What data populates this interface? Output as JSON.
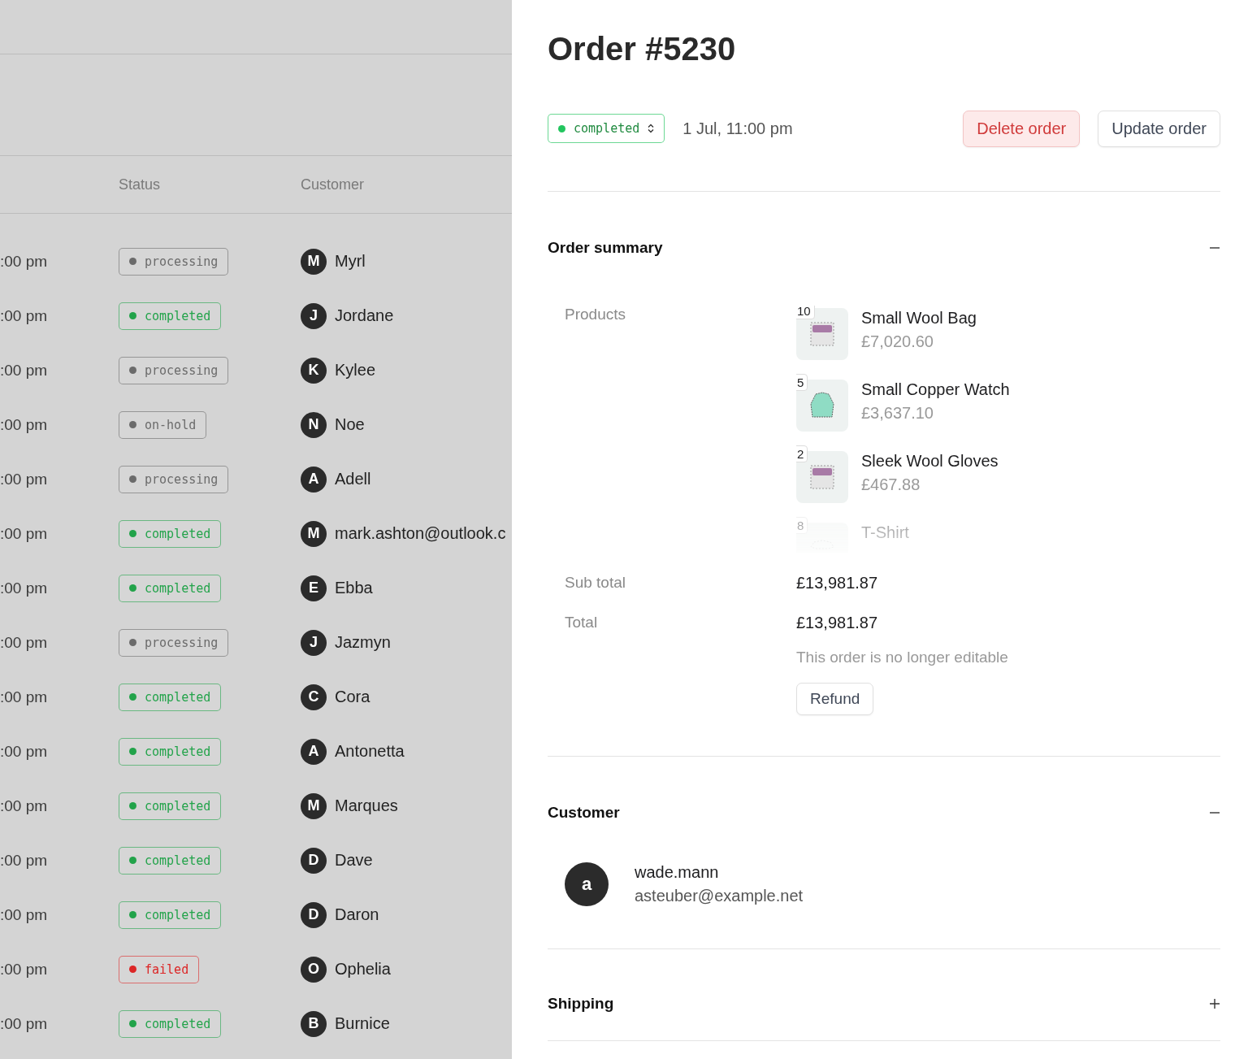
{
  "orders_table": {
    "columns": [
      "Status",
      "Customer"
    ],
    "rows": [
      {
        "time": ":00 pm",
        "status": {
          "label": "processing",
          "color": "#6b6b6b"
        },
        "initial": "M",
        "customer": "Myrl"
      },
      {
        "time": ":00 pm",
        "status": {
          "label": "completed",
          "color": "#22a34a"
        },
        "initial": "J",
        "customer": "Jordane"
      },
      {
        "time": ":00 pm",
        "status": {
          "label": "processing",
          "color": "#6b6b6b"
        },
        "initial": "K",
        "customer": "Kylee"
      },
      {
        "time": ":00 pm",
        "status": {
          "label": "on-hold",
          "color": "#6b6b6b"
        },
        "initial": "N",
        "customer": "Noe"
      },
      {
        "time": ":00 pm",
        "status": {
          "label": "processing",
          "color": "#6b6b6b"
        },
        "initial": "A",
        "customer": "Adell"
      },
      {
        "time": ":00 pm",
        "status": {
          "label": "completed",
          "color": "#22a34a"
        },
        "initial": "M",
        "customer": "mark.ashton@outlook.c"
      },
      {
        "time": ":00 pm",
        "status": {
          "label": "completed",
          "color": "#22a34a"
        },
        "initial": "E",
        "customer": "Ebba"
      },
      {
        "time": ":00 pm",
        "status": {
          "label": "processing",
          "color": "#6b6b6b"
        },
        "initial": "J",
        "customer": "Jazmyn"
      },
      {
        "time": ":00 pm",
        "status": {
          "label": "completed",
          "color": "#22a34a"
        },
        "initial": "C",
        "customer": "Cora"
      },
      {
        "time": ":00 pm",
        "status": {
          "label": "completed",
          "color": "#22a34a"
        },
        "initial": "A",
        "customer": "Antonetta"
      },
      {
        "time": ":00 pm",
        "status": {
          "label": "completed",
          "color": "#22a34a"
        },
        "initial": "M",
        "customer": "Marques"
      },
      {
        "time": ":00 pm",
        "status": {
          "label": "completed",
          "color": "#22a34a"
        },
        "initial": "D",
        "customer": "Dave"
      },
      {
        "time": ":00 pm",
        "status": {
          "label": "completed",
          "color": "#22a34a"
        },
        "initial": "D",
        "customer": "Daron"
      },
      {
        "time": ":00 pm",
        "status": {
          "label": "failed",
          "color": "#dc2626"
        },
        "initial": "O",
        "customer": "Ophelia"
      },
      {
        "time": ":00 pm",
        "status": {
          "label": "completed",
          "color": "#22a34a"
        },
        "initial": "B",
        "customer": "Burnice"
      }
    ]
  },
  "order": {
    "title": "Order #5230",
    "status": {
      "label": "completed",
      "color": "#22c55e"
    },
    "date": "1 Jul, 11:00 pm",
    "buttons": [
      {
        "label": "Delete order",
        "kind": "danger"
      },
      {
        "label": "Update order",
        "kind": "default"
      }
    ]
  },
  "summary": {
    "title": "Order summary",
    "expanded": true,
    "products_label": "Products",
    "products": [
      {
        "qty": "10",
        "name": "Small Wool Bag",
        "price": "£7,020.60",
        "kind": "woo"
      },
      {
        "qty": "5",
        "name": "Small Copper Watch",
        "price": "£3,637.10",
        "kind": "sweater"
      },
      {
        "qty": "2",
        "name": "Sleek Wool Gloves",
        "price": "£467.88",
        "kind": "woo"
      },
      {
        "qty": "8",
        "name": "T-Shirt",
        "kind": "shirt"
      }
    ],
    "totals": [
      {
        "label": "Sub total",
        "value": "£13,981.87"
      },
      {
        "label": "Total",
        "value": "£13,981.87"
      }
    ],
    "note": "This order is no longer editable",
    "refund": "Refund"
  },
  "customer": {
    "title": "Customer",
    "expanded": true,
    "initial": "a",
    "username": "wade.mann",
    "email": "asteuber@example.net"
  },
  "shipping": {
    "title": "Shipping",
    "expanded": false
  }
}
